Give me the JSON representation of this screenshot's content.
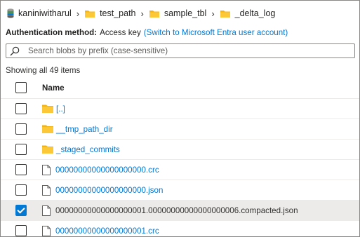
{
  "breadcrumb": {
    "items": [
      {
        "label": "kaniniwitharul",
        "icon": "storage-account-icon"
      },
      {
        "label": "test_path",
        "icon": "folder-icon"
      },
      {
        "label": "sample_tbl",
        "icon": "folder-icon"
      },
      {
        "label": "_delta_log",
        "icon": "folder-icon"
      }
    ]
  },
  "auth": {
    "label": "Authentication method:",
    "value": "Access key",
    "link": "(Switch to Microsoft Entra user account)"
  },
  "search": {
    "placeholder": "Search blobs by prefix (case-sensitive)",
    "value": ""
  },
  "status": {
    "showing": "Showing all 49 items"
  },
  "table": {
    "header": "Name",
    "rows": [
      {
        "name": "[..]",
        "type": "folder",
        "checked": false
      },
      {
        "name": "__tmp_path_dir",
        "type": "folder",
        "checked": false
      },
      {
        "name": "_staged_commits",
        "type": "folder",
        "checked": false
      },
      {
        "name": "00000000000000000000.crc",
        "type": "file",
        "checked": false
      },
      {
        "name": "00000000000000000000.json",
        "type": "file",
        "checked": false
      },
      {
        "name": "00000000000000000001.00000000000000000006.compacted.json",
        "type": "file",
        "checked": true
      },
      {
        "name": "00000000000000000001.crc",
        "type": "file",
        "checked": false
      }
    ]
  },
  "colors": {
    "link": "#0078d4",
    "folder": "#f6b40e",
    "selected_row": "#edebe9",
    "checkbox_checked": "#0078d4"
  }
}
